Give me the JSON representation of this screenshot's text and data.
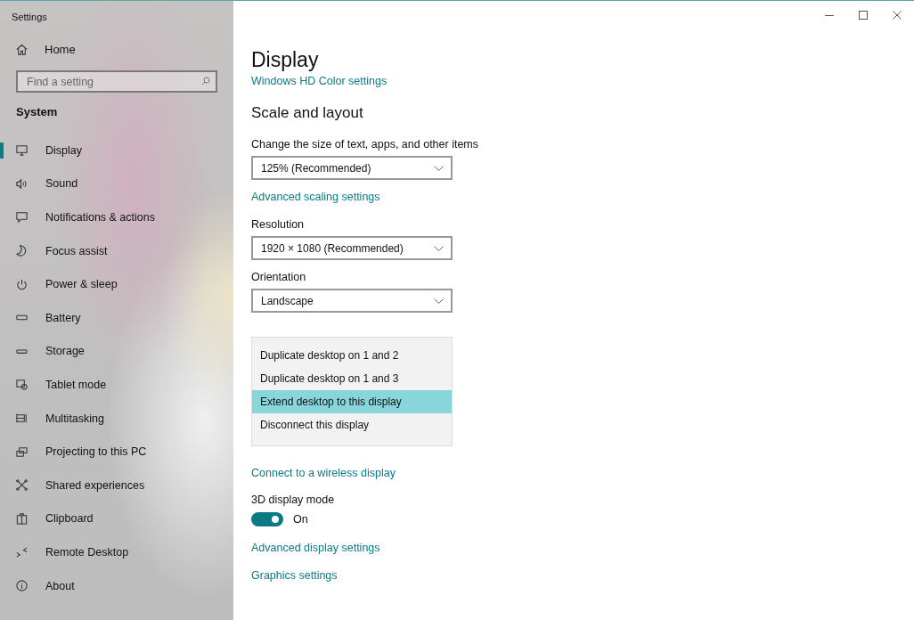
{
  "window": {
    "title": "Settings"
  },
  "sidebar": {
    "home": {
      "label": "Home"
    },
    "search": {
      "placeholder": "Find a setting"
    },
    "section": "System",
    "items": [
      {
        "label": "Display",
        "kind": "monitor",
        "selected": true
      },
      {
        "label": "Sound",
        "kind": "speaker",
        "selected": false
      },
      {
        "label": "Notifications & actions",
        "kind": "message",
        "selected": false
      },
      {
        "label": "Focus assist",
        "kind": "moon",
        "selected": false
      },
      {
        "label": "Power & sleep",
        "kind": "power",
        "selected": false
      },
      {
        "label": "Battery",
        "kind": "battery",
        "selected": false
      },
      {
        "label": "Storage",
        "kind": "storage",
        "selected": false
      },
      {
        "label": "Tablet mode",
        "kind": "tablet",
        "selected": false
      },
      {
        "label": "Multitasking",
        "kind": "multitask",
        "selected": false
      },
      {
        "label": "Projecting to this PC",
        "kind": "project",
        "selected": false
      },
      {
        "label": "Shared experiences",
        "kind": "shared",
        "selected": false
      },
      {
        "label": "Clipboard",
        "kind": "clipboard",
        "selected": false
      },
      {
        "label": "Remote Desktop",
        "kind": "remote",
        "selected": false
      },
      {
        "label": "About",
        "kind": "info",
        "selected": false
      }
    ]
  },
  "content": {
    "title": "Display",
    "hd_color_link": "Windows HD Color settings",
    "section_title": "Scale and layout",
    "scale": {
      "label": "Change the size of text, apps, and other items",
      "value": "125% (Recommended)"
    },
    "advanced_scaling_link": "Advanced scaling settings",
    "resolution": {
      "label": "Resolution",
      "value": "1920 × 1080 (Recommended)"
    },
    "orientation": {
      "label": "Orientation",
      "value": "Landscape"
    },
    "multiple_displays_menu": [
      {
        "label": "Duplicate desktop on 1 and 2",
        "selected": false
      },
      {
        "label": "Duplicate desktop on 1 and 3",
        "selected": false
      },
      {
        "label": "Extend desktop to this display",
        "selected": true
      },
      {
        "label": "Disconnect this display",
        "selected": false
      }
    ],
    "wireless_link": "Connect to a wireless display",
    "display_3d": {
      "label": "3D display mode",
      "on": true,
      "state_label": "On"
    },
    "advanced_display_link": "Advanced display settings",
    "graphics_link": "Graphics settings"
  }
}
